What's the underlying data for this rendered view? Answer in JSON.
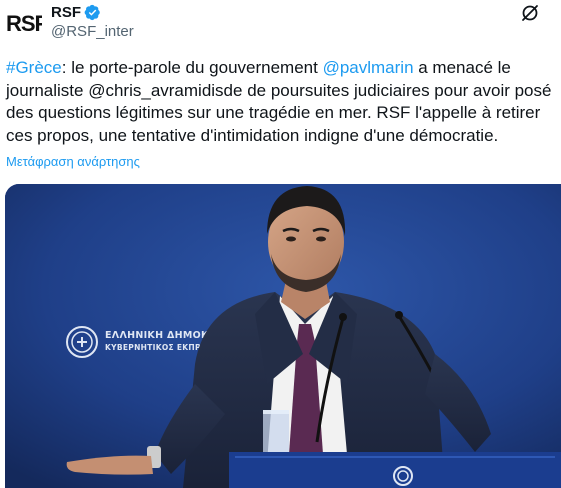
{
  "author": {
    "display_name": "RSF",
    "handle": "@RSF_inter",
    "avatar_text": "RSF",
    "verified_icon": "verified-badge-icon",
    "menu_icon": "grok-slash-icon"
  },
  "tweet": {
    "segments": [
      {
        "text": "#Grèce",
        "type": "hashtag"
      },
      {
        "text": ": le porte-parole du gouvernement ",
        "type": "text"
      },
      {
        "text": "@pavlmarin",
        "type": "mention"
      },
      {
        "text": " a menacé le journaliste @chris_avramidisde de poursuites judiciaires pour avoir posé des questions légitimes sur une tragédie en mer. RSF l'appelle à retirer ces propos, une tentative d'intimidation indigne d'une démocratie.",
        "type": "text"
      }
    ],
    "translate_label": "Μετάφραση ανάρτησης"
  },
  "media": {
    "backdrop_line1": "ΕΛΛΗΝΙΚΗ ΔΗΜΟΚΡΑΤΙΑ",
    "backdrop_line2": "ΚΥΒΕΡΝΗΤΙΚΟΣ ΕΚΠΡΟΣΩΠΟΣ"
  },
  "colors": {
    "link": "#1d9bf0",
    "text": "#0f1419",
    "secondary": "#536471",
    "backdrop_blue": "#1e3d82"
  }
}
